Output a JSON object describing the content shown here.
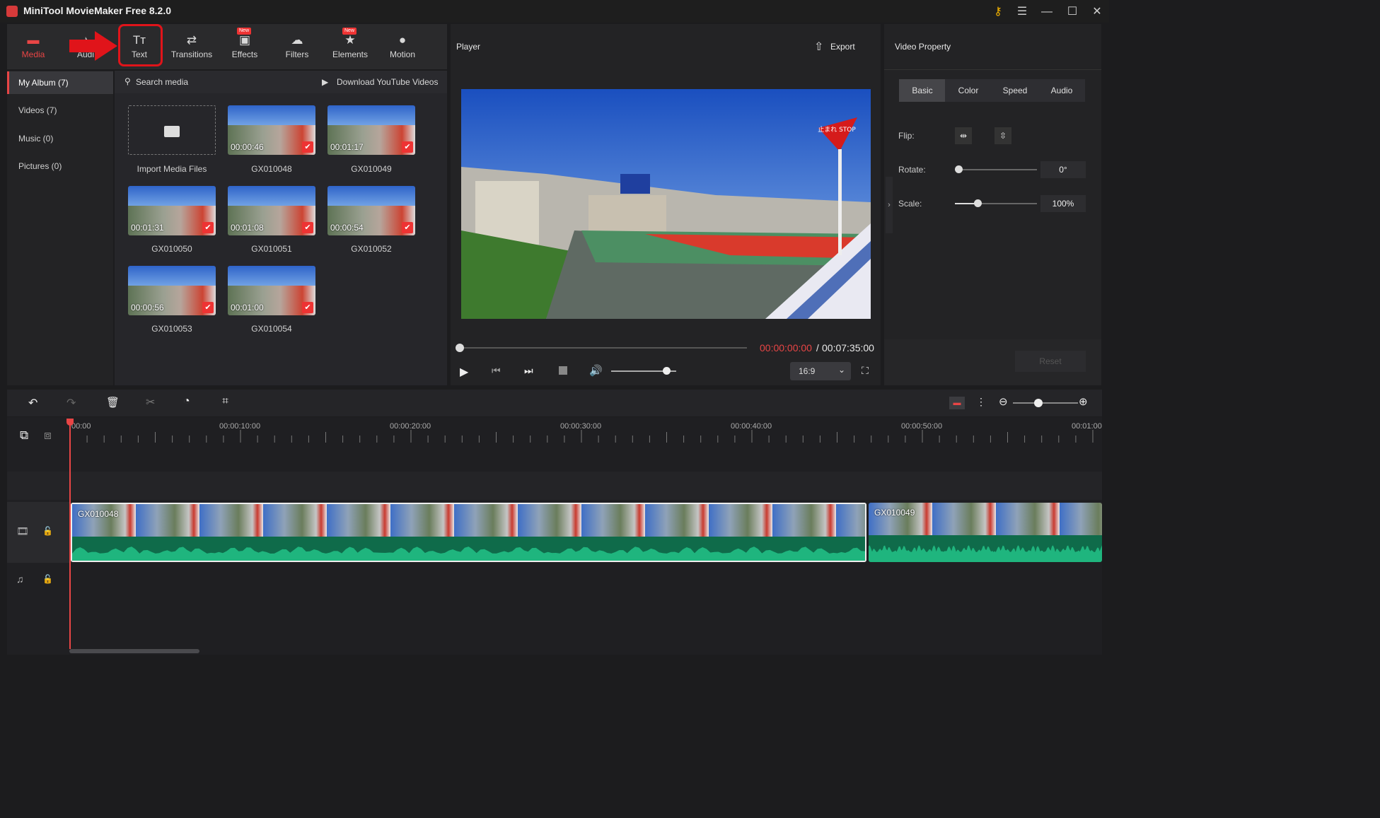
{
  "app": {
    "title": "MiniTool MovieMaker Free 8.2.0"
  },
  "toolbar": {
    "items": [
      {
        "label": "Media",
        "icon": "media-icon"
      },
      {
        "label": "Audi",
        "icon": "audio-icon"
      },
      {
        "label": "Text",
        "icon": "text-icon"
      },
      {
        "label": "Transitions",
        "icon": "transitions-icon"
      },
      {
        "label": "Effects",
        "icon": "effects-icon",
        "badge": "New"
      },
      {
        "label": "Filters",
        "icon": "filters-icon"
      },
      {
        "label": "Elements",
        "icon": "elements-icon",
        "badge": "New"
      },
      {
        "label": "Motion",
        "icon": "motion-icon"
      }
    ]
  },
  "sidebar": {
    "items": [
      {
        "label": "My Album (7)"
      },
      {
        "label": "Videos (7)"
      },
      {
        "label": "Music (0)"
      },
      {
        "label": "Pictures (0)"
      }
    ]
  },
  "media": {
    "search_placeholder": "Search media",
    "download_label": "Download YouTube Videos",
    "import_label": "Import Media Files",
    "items": [
      {
        "name": "GX010048",
        "duration": "00:00:46"
      },
      {
        "name": "GX010049",
        "duration": "00:01:17"
      },
      {
        "name": "GX010050",
        "duration": "00:01:31"
      },
      {
        "name": "GX010051",
        "duration": "00:01:08"
      },
      {
        "name": "GX010052",
        "duration": "00:00:54"
      },
      {
        "name": "GX010053",
        "duration": "00:00:56"
      },
      {
        "name": "GX010054",
        "duration": "00:01:00"
      }
    ]
  },
  "player": {
    "title": "Player",
    "export_label": "Export",
    "current_time": "00:00:00:00",
    "separator": " / ",
    "total_time": "00:07:35:00",
    "aspect": "16:9",
    "sign_text": "止まれ STOP",
    "progress": 0,
    "volume": 0.85
  },
  "property": {
    "title": "Video Property",
    "tabs": [
      "Basic",
      "Color",
      "Speed",
      "Audio"
    ],
    "flip_label": "Flip:",
    "rotate_label": "Rotate:",
    "rotate_value": "0°",
    "scale_label": "Scale:",
    "scale_value": "100%",
    "reset_label": "Reset"
  },
  "timeline": {
    "ticks": [
      "00:00",
      "00:00:10:00",
      "00:00:20:00",
      "00:00:30:00",
      "00:00:40:00",
      "00:00:50:00",
      "00:01:00"
    ],
    "clips": [
      {
        "name": "GX010048"
      },
      {
        "name": "GX010049"
      }
    ]
  },
  "colors": {
    "accent": "#e84545",
    "waveform": "#1fb57e",
    "highlight": "#e0141a"
  }
}
